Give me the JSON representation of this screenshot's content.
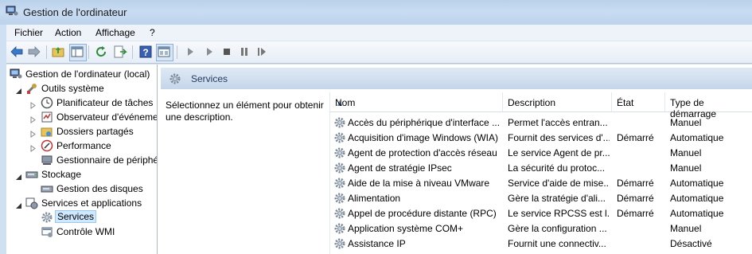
{
  "window": {
    "title": "Gestion de l'ordinateur"
  },
  "menu": [
    "Fichier",
    "Action",
    "Affichage",
    "?"
  ],
  "toolbar": [
    "back-icon",
    "forward-icon",
    "up-folder-icon",
    "show-hide-tree-icon",
    "refresh-icon",
    "export-list-icon",
    "help-icon",
    "properties-icon",
    "play-icon",
    "play-alt-icon",
    "stop-icon",
    "pause-icon",
    "restart-icon"
  ],
  "tree": {
    "root": "Gestion de l'ordinateur (local)",
    "system_tools": "Outils système",
    "task_scheduler": "Planificateur de tâches",
    "event_viewer": "Observateur d'événeme",
    "shared_folders": "Dossiers partagés",
    "performance": "Performance",
    "device_manager": "Gestionnaire de périphé",
    "storage": "Stockage",
    "disk_management": "Gestion des disques",
    "services_apps": "Services et applications",
    "services": "Services",
    "wmi_control": "Contrôle WMI"
  },
  "panel": {
    "title": "Services",
    "description": "Sélectionnez un élément pour obtenir une description."
  },
  "columns": {
    "name": "Nom",
    "description": "Description",
    "status": "État",
    "startup": "Type de démarrage"
  },
  "services": [
    {
      "name": "Accès du périphérique d'interface ...",
      "description": "Permet l'accès entran...",
      "status": "",
      "startup": "Manuel"
    },
    {
      "name": "Acquisition d'image Windows (WIA)",
      "description": "Fournit des services d'...",
      "status": "Démarré",
      "startup": "Automatique"
    },
    {
      "name": "Agent de protection d'accès réseau",
      "description": "Le service Agent de pr...",
      "status": "",
      "startup": "Manuel"
    },
    {
      "name": "Agent de stratégie IPsec",
      "description": "La sécurité du protoc...",
      "status": "",
      "startup": "Manuel"
    },
    {
      "name": "Aide de la mise à niveau VMware",
      "description": "Service d'aide de mise...",
      "status": "Démarré",
      "startup": "Automatique"
    },
    {
      "name": "Alimentation",
      "description": "Gère la stratégie d'ali...",
      "status": "Démarré",
      "startup": "Automatique"
    },
    {
      "name": "Appel de procédure distante (RPC)",
      "description": "Le service RPCSS est l...",
      "status": "Démarré",
      "startup": "Automatique"
    },
    {
      "name": "Application système COM+",
      "description": "Gère la configuration ...",
      "status": "",
      "startup": "Manuel"
    },
    {
      "name": "Assistance IP",
      "description": "Fournit une connectiv...",
      "status": "",
      "startup": "Désactivé"
    }
  ]
}
